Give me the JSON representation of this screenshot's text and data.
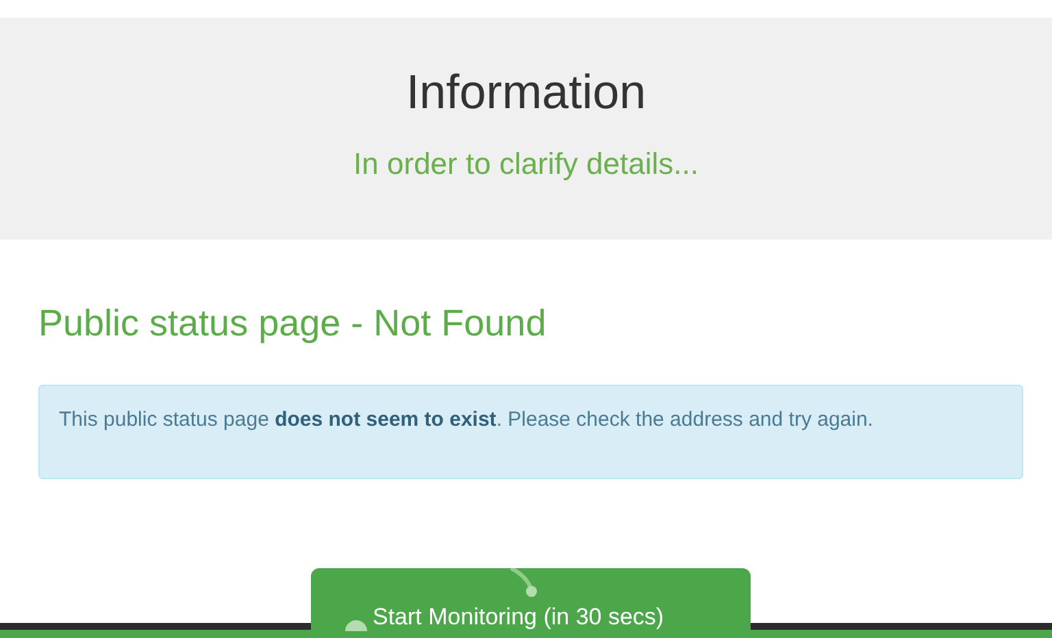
{
  "header": {
    "title": "Information",
    "subtitle": "In order to clarify details..."
  },
  "heading": "Public status page - Not Found",
  "alert": {
    "message": "This public status page **does not seem to exist**. Please check the address and try again."
  },
  "footer_button": {
    "label": "Start Monitoring (in 30 secs)"
  }
}
